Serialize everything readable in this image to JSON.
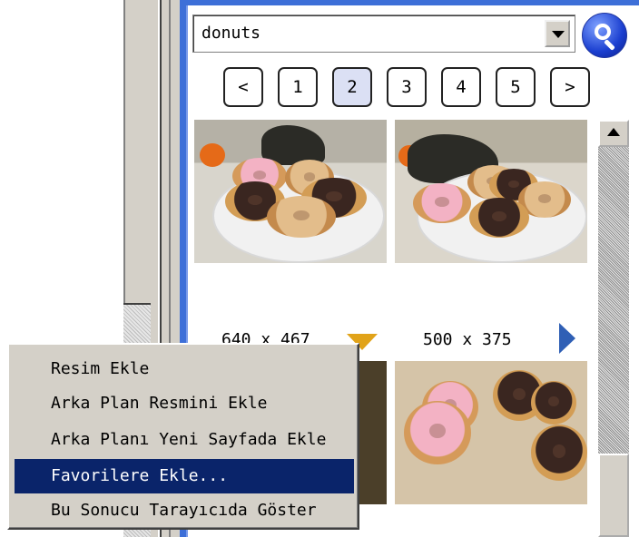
{
  "search": {
    "query": "donuts"
  },
  "pagination": {
    "prev": "<",
    "pages": [
      "1",
      "2",
      "3",
      "4",
      "5"
    ],
    "next": ">",
    "active_page": "2"
  },
  "results": [
    {
      "dimensions": "640 x 467"
    },
    {
      "dimensions": "500 x 375"
    }
  ],
  "context_menu": {
    "items": [
      "Resim Ekle",
      "Arka Plan Resmini Ekle",
      "Arka Planı Yeni Sayfada Ekle",
      "Favorilere Ekle...",
      "Bu Sonucu Tarayıcıda Göster"
    ],
    "highlighted": "Favorilere Ekle..."
  },
  "colors": {
    "panel_border": "#3d6fd8",
    "menu_highlight": "#0a246a",
    "menu_background": "#d4d0c8",
    "active_page": "#dbe0f4",
    "down_arrow": "#e1a319",
    "next_arrow": "#2f5fb5"
  },
  "icons": {
    "search_button": "magnifier-icon",
    "dropdown": "chevron-down-icon",
    "expand_result": "triangle-down-icon",
    "next_result": "triangle-right-icon"
  }
}
